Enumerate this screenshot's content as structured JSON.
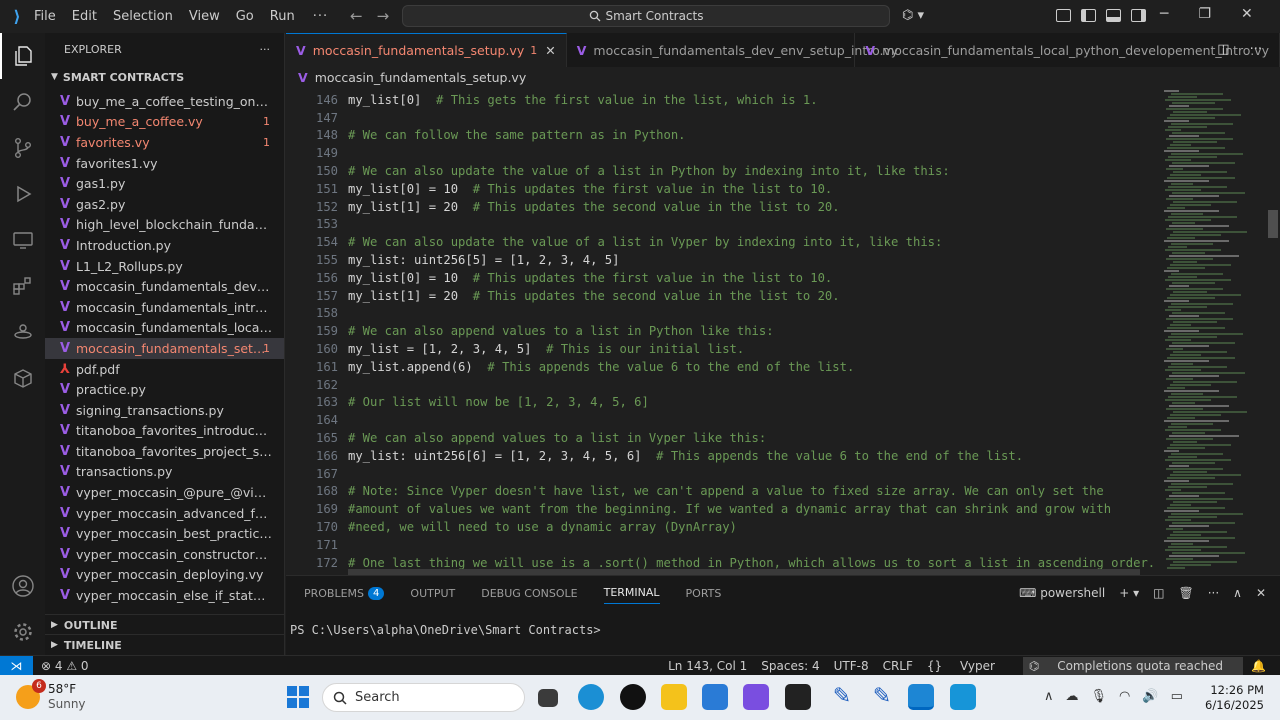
{
  "titlebar": {
    "menu": [
      "File",
      "Edit",
      "Selection",
      "View",
      "Go",
      "Run"
    ],
    "more": "···",
    "search": "Smart Contracts"
  },
  "sidebar": {
    "title": "EXPLORER",
    "folder": "SMART CONTRACTS",
    "files": [
      {
        "name": "buy_me_a_coffee_testing_on_tenderl...",
        "icon": "vyper-icon",
        "error": false,
        "badge": ""
      },
      {
        "name": "buy_me_a_coffee.vy",
        "icon": "vyper-icon",
        "error": true,
        "badge": "1"
      },
      {
        "name": "favorites.vy",
        "icon": "vyper-icon",
        "error": true,
        "badge": "1"
      },
      {
        "name": "favorites1.vy",
        "icon": "vyper-icon",
        "error": false,
        "badge": ""
      },
      {
        "name": "gas1.py",
        "icon": "vyper-icon",
        "error": false,
        "badge": ""
      },
      {
        "name": "gas2.py",
        "icon": "vyper-icon",
        "error": false,
        "badge": ""
      },
      {
        "name": "high_level_blockchain_fundamentals....",
        "icon": "vyper-icon",
        "error": false,
        "badge": ""
      },
      {
        "name": "Introduction.py",
        "icon": "vyper-icon",
        "error": false,
        "badge": ""
      },
      {
        "name": "L1_L2_Rollups.py",
        "icon": "vyper-icon",
        "error": false,
        "badge": ""
      },
      {
        "name": "moccasin_fundamentals_dev_env_set...",
        "icon": "vyper-icon",
        "error": false,
        "badge": ""
      },
      {
        "name": "moccasin_fundamentals_introductio...",
        "icon": "vyper-icon",
        "error": false,
        "badge": ""
      },
      {
        "name": "moccasin_fundamentals_local_pytho...",
        "icon": "vyper-icon",
        "error": false,
        "badge": ""
      },
      {
        "name": "moccasin_fundamentals_setup.vy",
        "icon": "vyper-icon",
        "error": true,
        "badge": "1",
        "selected": true
      },
      {
        "name": "pdf.pdf",
        "icon": "pdf-icon",
        "error": false,
        "badge": ""
      },
      {
        "name": "practice.py",
        "icon": "vyper-icon",
        "error": false,
        "badge": ""
      },
      {
        "name": "signing_transactions.py",
        "icon": "vyper-icon",
        "error": false,
        "badge": ""
      },
      {
        "name": "titanoboa_favorites_introduction.vy",
        "icon": "vyper-icon",
        "error": false,
        "badge": ""
      },
      {
        "name": "titanoboa_favorites_project_setup.vy",
        "icon": "vyper-icon",
        "error": false,
        "badge": ""
      },
      {
        "name": "transactions.py",
        "icon": "vyper-icon",
        "error": false,
        "badge": ""
      },
      {
        "name": "vyper_moccasin_@pure_@view.vy",
        "icon": "vyper-icon",
        "error": false,
        "badge": ""
      },
      {
        "name": "vyper_moccasin_advanced_functions...",
        "icon": "vyper-icon",
        "error": false,
        "badge": ""
      },
      {
        "name": "vyper_moccasin_best_practices.py",
        "icon": "vyper-icon",
        "error": false,
        "badge": ""
      },
      {
        "name": "vyper_moccasin_constructor_init_@d...",
        "icon": "vyper-icon",
        "error": false,
        "badge": ""
      },
      {
        "name": "vyper_moccasin_deploying.vy",
        "icon": "vyper-icon",
        "error": false,
        "badge": ""
      },
      {
        "name": "vyper_moccasin_else_if_statements.vy",
        "icon": "vyper-icon",
        "error": false,
        "badge": ""
      }
    ],
    "outline": "OUTLINE",
    "timeline": "TIMELINE"
  },
  "tabs": [
    {
      "label": "moccasin_fundamentals_setup.vy",
      "marker": "1",
      "active": true
    },
    {
      "label": "moccasin_fundamentals_dev_env_setup_intro.vy",
      "marker": "",
      "active": false
    },
    {
      "label": "moccasin_fundamentals_local_python_developement_intro.vy",
      "marker": "",
      "active": false
    }
  ],
  "breadcrumb": "moccasin_fundamentals_setup.vy",
  "editor": {
    "lines": [
      {
        "n": "146",
        "code": "my_list[0]",
        "comment": "  # This gets the first value in the list, which is 1."
      },
      {
        "n": "147",
        "code": "",
        "comment": ""
      },
      {
        "n": "148",
        "code": "",
        "comment": "# We can follow the same pattern as in Python."
      },
      {
        "n": "149",
        "code": "",
        "comment": ""
      },
      {
        "n": "150",
        "code": "",
        "comment": "# We can also update the value of a list in Python by indexing into it, like this:"
      },
      {
        "n": "151",
        "code": "my_list[0] = 10",
        "comment": "  # This updates the first value in the list to 10."
      },
      {
        "n": "152",
        "code": "my_list[1] = 20",
        "comment": "  # This updates the second value in the list to 20."
      },
      {
        "n": "153",
        "code": "",
        "comment": ""
      },
      {
        "n": "154",
        "code": "",
        "comment": "# We can also update the value of a list in Vyper by indexing into it, like this:"
      },
      {
        "n": "155",
        "code": "my_list: uint256[5] = [1, 2, 3, 4, 5]",
        "comment": ""
      },
      {
        "n": "156",
        "code": "my_list[0] = 10",
        "comment": "  # This updates the first value in the list to 10."
      },
      {
        "n": "157",
        "code": "my_list[1] = 20",
        "comment": "  # This updates the second value in the list to 20."
      },
      {
        "n": "158",
        "code": "",
        "comment": ""
      },
      {
        "n": "159",
        "code": "",
        "comment": "# We can also append values to a list in Python like this:"
      },
      {
        "n": "160",
        "code": "my_list = [1, 2, 3, 4, 5]",
        "comment": "  # This is our initial list."
      },
      {
        "n": "161",
        "code": "my_list.append(6)",
        "comment": "  # This appends the value 6 to the end of the list."
      },
      {
        "n": "162",
        "code": "",
        "comment": ""
      },
      {
        "n": "163",
        "code": "",
        "comment": "# Our list will now be [1, 2, 3, 4, 5, 6]"
      },
      {
        "n": "164",
        "code": "",
        "comment": ""
      },
      {
        "n": "165",
        "code": "",
        "comment": "# We can also append values to a list in Vyper like this:"
      },
      {
        "n": "166",
        "code": "my_list: uint256[6] = [1, 2, 3, 4, 5, 6]",
        "comment": "  # This appends the value 6 to the end of the list."
      },
      {
        "n": "167",
        "code": "",
        "comment": ""
      },
      {
        "n": "168",
        "code": "",
        "comment": "# Note: Since Vyper doesn't have list, we can't append a value to fixed size array. We can only set the"
      },
      {
        "n": "169",
        "code": "",
        "comment": "#amount of values we want from the beginning. If we wanted a dynamic array that can shrink and grow with"
      },
      {
        "n": "170",
        "code": "",
        "comment": "#need, we will need to use a dynamic array (DynArray)"
      },
      {
        "n": "171",
        "code": "",
        "comment": ""
      },
      {
        "n": "172",
        "code": "",
        "comment": "# One last thing we will use is a .sort() method in Python, which allows us to sort a list in ascending order."
      }
    ]
  },
  "panel": {
    "tabs": [
      {
        "label": "PROBLEMS",
        "badge": "4",
        "active": false
      },
      {
        "label": "OUTPUT",
        "badge": "",
        "active": false
      },
      {
        "label": "DEBUG CONSOLE",
        "badge": "",
        "active": false
      },
      {
        "label": "TERMINAL",
        "badge": "",
        "active": true
      },
      {
        "label": "PORTS",
        "badge": "",
        "active": false
      }
    ],
    "shell": "powershell",
    "prompt": "PS C:\\Users\\alpha\\OneDrive\\Smart Contracts>"
  },
  "statusbar": {
    "problems": "⊗ 4 ⚠ 0",
    "position": "Ln 143, Col 1",
    "spaces": "Spaces: 4",
    "encoding": "UTF-8",
    "eol": "CRLF",
    "language": "Vyper",
    "quota": "Completions quota reached"
  },
  "taskbar": {
    "temp": "58°F",
    "weather": "Sunny",
    "weather_badge": "6",
    "search": "Search",
    "time": "12:26 PM",
    "date": "6/16/2025"
  },
  "colors": {
    "accent": "#0078d4",
    "error": "#f48771",
    "comment": "#6a9955",
    "vyper": "#9b5de5"
  }
}
